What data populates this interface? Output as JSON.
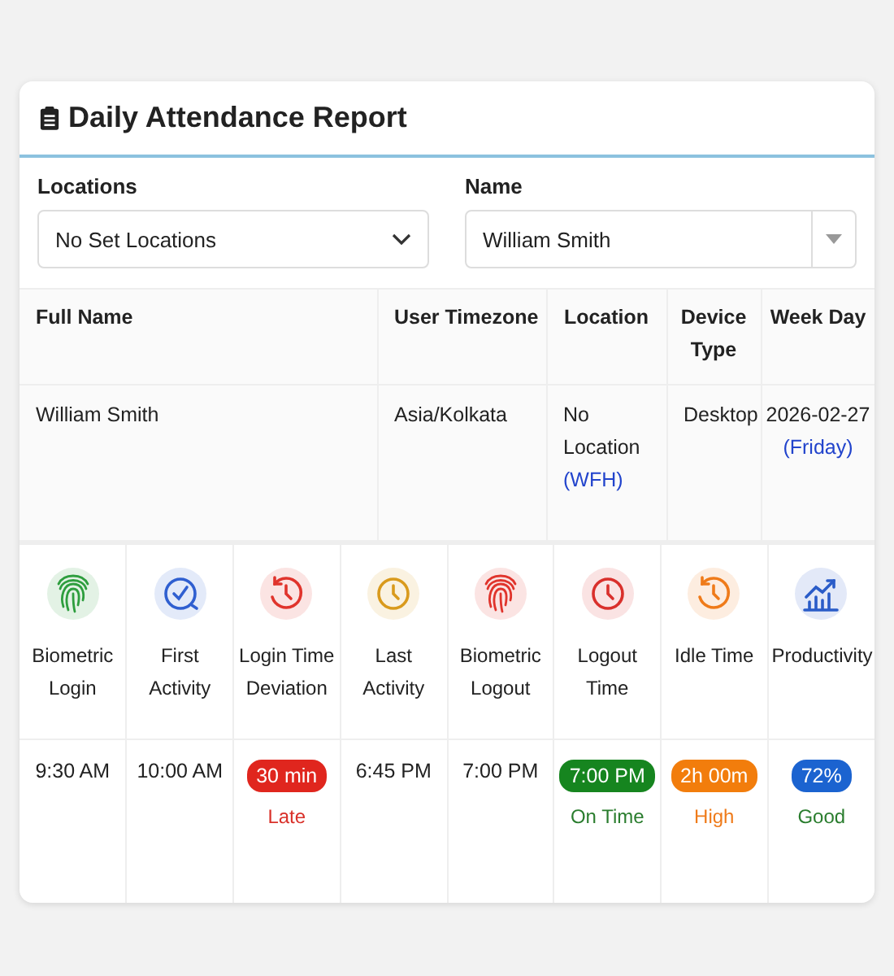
{
  "title": "Daily Attendance Report",
  "filters": [
    {
      "label": "Locations",
      "value": "No Set Locations",
      "kind": "select"
    },
    {
      "label": "Name",
      "value": "William Smith",
      "kind": "combo"
    }
  ],
  "summary": {
    "columns": [
      "Full Name",
      "User Timezone",
      "Location",
      "Device Type",
      "Week Day"
    ],
    "row": {
      "full_name": "William Smith",
      "timezone": "Asia/Kolkata",
      "location": "No Location",
      "location_tag": "(WFH)",
      "device": "Desktop",
      "date": "2026-02-27",
      "weekday": "(Friday)"
    }
  },
  "metrics": [
    {
      "kind": "fingerprint",
      "color": "#2e9e3e",
      "label": "Biometric Login",
      "value": "9:30 AM"
    },
    {
      "kind": "clock-check",
      "color": "#2f5fd0",
      "label": "First Activity",
      "value": "10:00 AM"
    },
    {
      "kind": "clock-history",
      "color": "#e0342c",
      "label": "Login Time Deviation",
      "badge": {
        "text": "30 min",
        "color": "#e0261e"
      },
      "status": {
        "text": "Late",
        "color": "#d9312a"
      }
    },
    {
      "kind": "clock",
      "color": "#d99a1c",
      "label": "Last Activity",
      "value": "6:45 PM"
    },
    {
      "kind": "fingerprint",
      "color": "#e0342c",
      "label": "Biometric Logout",
      "value": "7:00 PM"
    },
    {
      "kind": "clock",
      "color": "#d9302c",
      "label": "Logout Time",
      "badge": {
        "text": "7:00 PM",
        "color": "#16851f"
      },
      "status": {
        "text": "On Time",
        "color": "#2a7d2e"
      }
    },
    {
      "kind": "clock-history",
      "color": "#ef7b1a",
      "label": "Idle Time",
      "badge": {
        "text": "2h 00m",
        "color": "#f27d0c"
      },
      "status": {
        "text": "High",
        "color": "#ef7b1a"
      }
    },
    {
      "kind": "chart",
      "color": "#2a5cc8",
      "label": "Productivity",
      "badge": {
        "text": "72%",
        "color": "#1b63d0"
      },
      "status": {
        "text": "Good",
        "color": "#2a7d2e"
      }
    }
  ]
}
